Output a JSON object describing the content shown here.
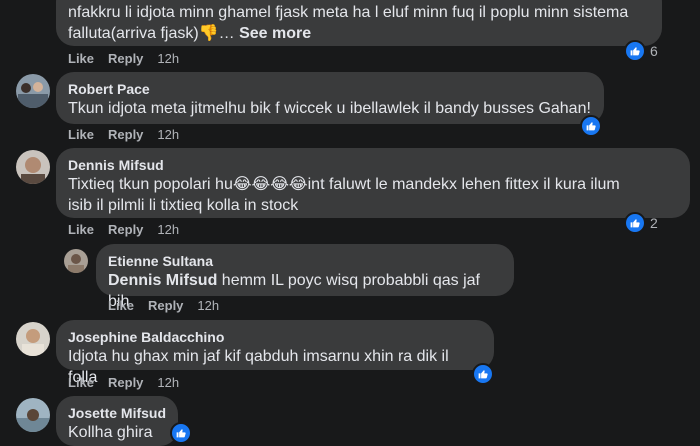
{
  "comments": [
    {
      "text": "nfakkru li idjota minn ghamel fjask meta ha l eluf minn fuq il poplu minn sistema falluta(arriva fjask)👎…",
      "see_more": "See more",
      "like": "Like",
      "reply": "Reply",
      "time": "12h",
      "reactions": "6"
    },
    {
      "author": "Robert Pace",
      "text": "Tkun idjota meta jitmelhu bik f wiccek u ibellawlek il bandy busses Gahan!",
      "like": "Like",
      "reply": "Reply",
      "time": "12h"
    },
    {
      "author": "Dennis Mifsud",
      "text_a": "Tixtieq tkun popolari hu😂😂😂😂int faluwt le mandekx lehen fittex il kura ilum",
      "text_b": "isib il pilmli li tixtieq kolla in stock",
      "like": "Like",
      "reply": "Reply",
      "time": "12h",
      "reactions": "2"
    },
    {
      "author": "Etienne Sultana",
      "mention": "Dennis Mifsud",
      "text": " hemm IL poyc wisq probabbli qas jaf bih",
      "like": "Like",
      "reply": "Reply",
      "time": "12h"
    },
    {
      "author": "Josephine Baldacchino",
      "text": "Idjota hu ghax min jaf kif qabduh imsarnu xhin ra dik il folla",
      "like": "Like",
      "reply": "Reply",
      "time": "12h"
    },
    {
      "author": "Josette Mifsud",
      "text": "Kollha ghira"
    }
  ],
  "colors": {
    "bubble": "#3a3b3c",
    "background": "#18191a",
    "like_blue": "#1877f2"
  },
  "icons": {
    "reaction": "thumbs-up-icon"
  }
}
